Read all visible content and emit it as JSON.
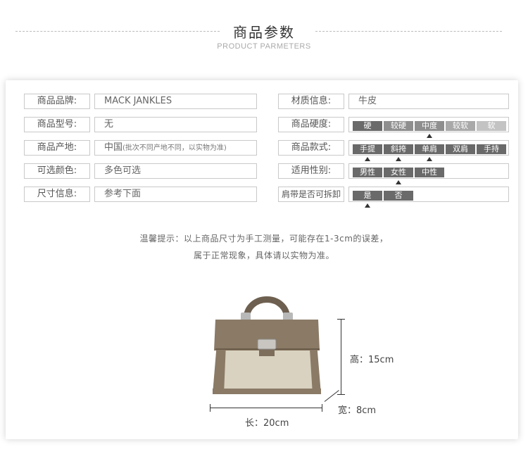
{
  "header": {
    "title": "商品参数",
    "subtitle": "PRODUCT PARMETERS"
  },
  "left_rows": [
    {
      "label": "商品品牌:",
      "value": "MACK JANKLES"
    },
    {
      "label": "商品型号:",
      "value": "无"
    },
    {
      "label": "商品产地:",
      "value": "中国",
      "note": "(批次不同产地不同，以实物为准)"
    },
    {
      "label": "可选颜色:",
      "value": "多色可选"
    },
    {
      "label": "尺寸信息:",
      "value": "参考下面"
    }
  ],
  "right_rows": [
    {
      "label": "材质信息:",
      "value": "牛皮"
    },
    {
      "label": "商品硬度:",
      "options": [
        "硬",
        "较硬",
        "中度",
        "较软",
        "软"
      ],
      "selected": "中度"
    },
    {
      "label": "商品款式:",
      "options": [
        "手提",
        "斜挎",
        "单肩",
        "双肩",
        "手持"
      ],
      "selected": [
        "手提",
        "斜挎",
        "单肩"
      ]
    },
    {
      "label": "适用性别:",
      "options": [
        "男性",
        "女性",
        "中性"
      ],
      "selected": "女性"
    },
    {
      "label": "肩带是否可拆卸",
      "options": [
        "是",
        "否"
      ],
      "selected": "是"
    }
  ],
  "tip": {
    "line1": "温馨提示：以上商品尺寸为手工测量，可能存在1-3cm的误差，",
    "line2": "属于正常现象，具体请以实物为准。"
  },
  "dimensions": {
    "height": "高：15cm",
    "width": "宽：8cm",
    "length": "长：20cm"
  },
  "colors": {
    "chip_dark": "#6a6a6a",
    "chip_mid": "#8e8e8e",
    "chip_light": "#a9a9a9",
    "chip_lighter": "#c3c3c3",
    "bag_leather": "#8a7a66",
    "bag_canvas": "#d9d2c0"
  }
}
